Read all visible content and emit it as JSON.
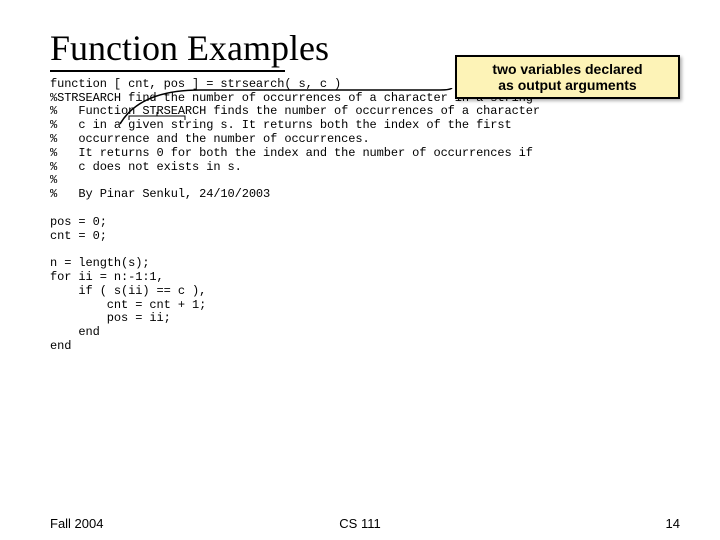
{
  "title": "Function Examples",
  "callout": {
    "line1": "two variables declared",
    "line2": "as output arguments"
  },
  "code": {
    "l01": "function [ cnt, pos ] = strsearch( s, c )",
    "l02": "%STRSEARCH find the number of occurrences of a character in a string",
    "l03": "%   Function STRSEARCH finds the number of occurrences of a character",
    "l04": "%   c in a given string s. It returns both the index of the first",
    "l05": "%   occurrence and the number of occurrences.",
    "l06": "%   It returns 0 for both the index and the number of occurrences if",
    "l07": "%   c does not exists in s.",
    "l08": "%",
    "l09": "%   By Pinar Senkul, 24/10/2003",
    "l10": "",
    "l11": "pos = 0;",
    "l12": "cnt = 0;",
    "l13": "",
    "l14": "n = length(s);",
    "l15": "for ii = n:-1:1,",
    "l16": "    if ( s(ii) == c ),",
    "l17": "        cnt = cnt + 1;",
    "l18": "        pos = ii;",
    "l19": "    end",
    "l20": "end"
  },
  "footer": {
    "left": "Fall 2004",
    "center": "CS 111",
    "right": "14"
  }
}
